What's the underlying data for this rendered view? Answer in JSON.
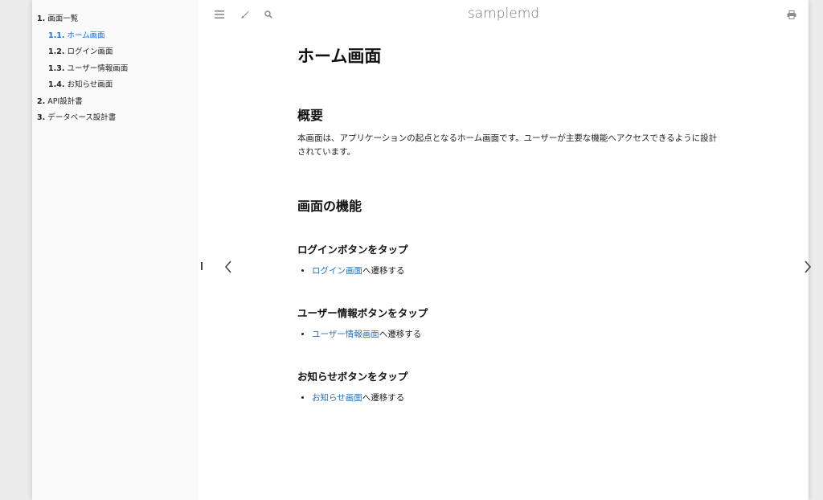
{
  "sidebar": {
    "items": [
      {
        "num": "1.",
        "label": "画面一覧"
      },
      {
        "num": "1.1.",
        "label": "ホーム画面"
      },
      {
        "num": "1.2.",
        "label": "ログイン画面"
      },
      {
        "num": "1.3.",
        "label": "ユーザー情報画面"
      },
      {
        "num": "1.4.",
        "label": "お知らせ画面"
      },
      {
        "num": "2.",
        "label": "API設計書"
      },
      {
        "num": "3.",
        "label": "データベース設計書"
      }
    ]
  },
  "menu": {
    "title": "samplemd",
    "icons": [
      "menu-icon",
      "paintbrush-icon",
      "search-icon",
      "print-icon"
    ]
  },
  "content": {
    "page_title": "ホーム画面",
    "overview_heading": "概要",
    "overview_text": "本画面は、アプリケーションの起点となるホーム画面です。ユーザーが主要な機能へアクセスできるように設計されています。",
    "features_heading": "画面の機能",
    "sections": [
      {
        "heading": "ログインボタンをタップ",
        "link": "ログイン画面",
        "suffix": "へ遷移する"
      },
      {
        "heading": "ユーザー情報ボタンをタップ",
        "link": "ユーザー情報画面",
        "suffix": "へ遷移する"
      },
      {
        "heading": "お知らせボタンをタップ",
        "link": "お知らせ画面",
        "suffix": "へ遷移する"
      }
    ]
  },
  "colors": {
    "accent": "#1f6fd6",
    "link": "#2a6fb6",
    "sidebar_bg": "#fafafa"
  }
}
